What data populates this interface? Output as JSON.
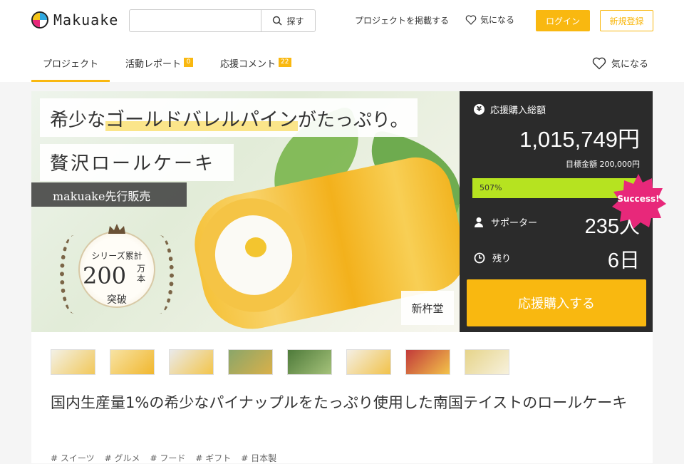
{
  "header": {
    "logo_text": "Makuake",
    "search": {
      "placeholder": "",
      "button_label": "探す"
    },
    "post_project_label": "プロジェクトを掲載する",
    "favorite_label": "気になる",
    "login_label": "ログイン",
    "signup_label": "新規登録"
  },
  "tabs": [
    {
      "label": "プロジェクト",
      "active": true
    },
    {
      "label": "活動レポート",
      "badge": "0"
    },
    {
      "label": "応援コメント",
      "badge": "22"
    }
  ],
  "tab_favorite_label": "気になる",
  "hero": {
    "headline_part1": "希少な",
    "headline_highlight": "ゴールドバレルパイン",
    "headline_part2": "がたっぷり。",
    "headline_line2": "贅沢ロールケーキ",
    "presale_label": "makuake先行販売",
    "emblem_top": "シリーズ累計",
    "emblem_number": "200",
    "emblem_unit": "万本",
    "emblem_bottom": "突破",
    "brand": "新杵堂"
  },
  "stats": {
    "total_label": "応援購入総額",
    "amount": "1,015,749円",
    "goal": "目標金額 200,000円",
    "progress_text": "507%",
    "progress_fraction": 1.0,
    "supporters_label": "サポーター",
    "supporters_value": "235人",
    "remaining_label": "残り",
    "remaining_value": "6日",
    "support_button": "応援購入する",
    "success_badge": "Success!"
  },
  "thumbnails": [
    "thumb-1",
    "thumb-2",
    "thumb-3",
    "thumb-4",
    "thumb-5",
    "thumb-6",
    "thumb-7",
    "thumb-8"
  ],
  "project_title": "国内生産量1%の希少なパイナップルをたっぷり使用した南国テイストのロールケーキ",
  "tags": [
    "# スイーツ",
    "# グルメ",
    "# フード",
    "# ギフト",
    "# 日本製"
  ],
  "colors": {
    "accent": "#f9b810",
    "progress": "#b6e320",
    "success": "#e8287a",
    "stats_bg": "#2b2b2b"
  }
}
